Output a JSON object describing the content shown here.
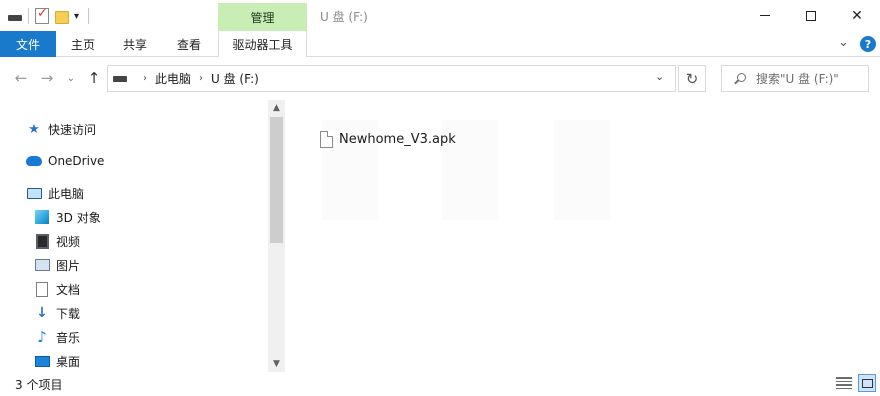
{
  "window": {
    "title": "U 盘 (F:)",
    "context_tab": "管理"
  },
  "ribbon": {
    "tabs": [
      "文件",
      "主页",
      "共享",
      "查看",
      "驱动器工具"
    ],
    "help": "?"
  },
  "address": {
    "segments": [
      "此电脑",
      "U 盘 (F:)"
    ],
    "search_placeholder": "搜索\"U 盘 (F:)\""
  },
  "nav_pane": {
    "items": [
      {
        "label": "快速访问",
        "icon": "star-icon"
      },
      {
        "label": "OneDrive",
        "icon": "cloud-icon"
      },
      {
        "label": "此电脑",
        "icon": "computer-icon"
      },
      {
        "label": "3D 对象",
        "icon": "3d-objects-icon"
      },
      {
        "label": "视频",
        "icon": "video-icon"
      },
      {
        "label": "图片",
        "icon": "pictures-icon"
      },
      {
        "label": "文档",
        "icon": "documents-icon"
      },
      {
        "label": "下载",
        "icon": "download-icon"
      },
      {
        "label": "音乐",
        "icon": "music-icon"
      },
      {
        "label": "桌面",
        "icon": "desktop-icon"
      }
    ]
  },
  "content": {
    "files": [
      {
        "name": "Newhome_V3.apk",
        "icon": "file-icon"
      }
    ]
  },
  "status": {
    "item_count": "3 个项目"
  },
  "colors": {
    "accent": "#1979ca",
    "manage_tab": "#c8eeb5"
  }
}
